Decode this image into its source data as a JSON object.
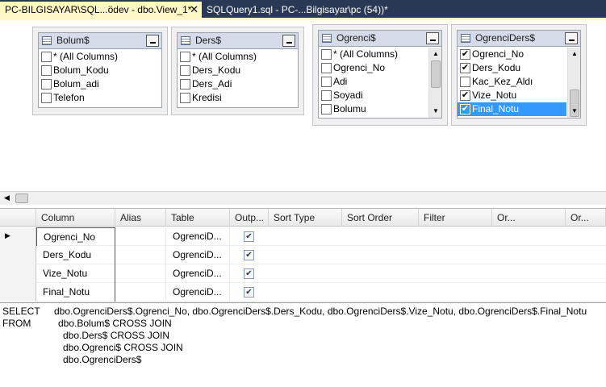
{
  "tabs": [
    {
      "label": "PC-BILGISAYAR\\SQL...ödev - dbo.View_1*",
      "close": "✕"
    },
    {
      "label": "SQLQuery1.sql - PC-...Bilgisayar\\pc (54))*"
    }
  ],
  "tables": [
    {
      "title": "Bolum$",
      "items": [
        {
          "label": "* (All Columns)",
          "checked": false
        },
        {
          "label": "Bolum_Kodu",
          "checked": false
        },
        {
          "label": "Bolum_adi",
          "checked": false
        },
        {
          "label": "Telefon",
          "checked": false
        }
      ]
    },
    {
      "title": "Ders$",
      "items": [
        {
          "label": "* (All Columns)",
          "checked": false
        },
        {
          "label": "Ders_Kodu",
          "checked": false
        },
        {
          "label": "Ders_Adi",
          "checked": false
        },
        {
          "label": "Kredisi",
          "checked": false
        }
      ]
    },
    {
      "title": "Ogrenci$",
      "items": [
        {
          "label": "* (All Columns)",
          "checked": false
        },
        {
          "label": "Ogrenci_No",
          "checked": false
        },
        {
          "label": "Adi",
          "checked": false
        },
        {
          "label": "Soyadi",
          "checked": false
        },
        {
          "label": "Bolumu",
          "checked": false
        }
      ]
    },
    {
      "title": "OgrenciDers$",
      "items": [
        {
          "label": "Ogrenci_No",
          "checked": true
        },
        {
          "label": "Ders_Kodu",
          "checked": true
        },
        {
          "label": "Kac_Kez_Aldı",
          "checked": false
        },
        {
          "label": "Vize_Notu",
          "checked": true
        },
        {
          "label": "Final_Notu",
          "checked": true,
          "selected": true
        }
      ]
    }
  ],
  "grid": {
    "headers": [
      "Column",
      "Alias",
      "Table",
      "Outp...",
      "Sort Type",
      "Sort Order",
      "Filter",
      "Or...",
      "Or..."
    ],
    "rows": [
      {
        "column": "Ogrenci_No",
        "alias": "",
        "table": "OgrenciD...",
        "output": true,
        "current": true
      },
      {
        "column": "Ders_Kodu",
        "alias": "",
        "table": "OgrenciD...",
        "output": true
      },
      {
        "column": "Vize_Notu",
        "alias": "",
        "table": "OgrenciD...",
        "output": true
      },
      {
        "column": "Final_Notu",
        "alias": "",
        "table": "OgrenciD...",
        "output": true
      }
    ]
  },
  "sql": {
    "select_kw": "SELECT",
    "from_kw": "FROM",
    "select_list": "dbo.OgrenciDers$.Ogrenci_No, dbo.OgrenciDers$.Ders_Kodu, dbo.OgrenciDers$.Vize_Notu, dbo.OgrenciDers$.Final_Notu",
    "from_lines": [
      "dbo.Bolum$ CROSS JOIN",
      "dbo.Ders$ CROSS JOIN",
      "dbo.Ogrenci$ CROSS JOIN",
      "dbo.OgrenciDers$"
    ]
  }
}
